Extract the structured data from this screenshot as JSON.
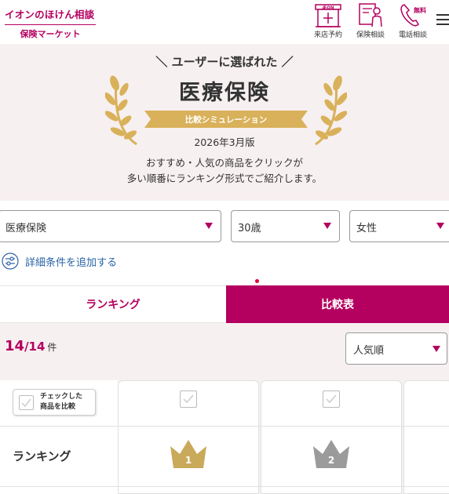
{
  "header": {
    "logo_main": "イオンのほけん相談",
    "logo_sub": "保険マーケット",
    "nav": [
      {
        "label": "来店予約",
        "icon": "store-icon"
      },
      {
        "label": "保険相談",
        "icon": "consultation-icon"
      },
      {
        "label": "電話相談",
        "icon": "phone-icon",
        "badge": "無料"
      }
    ],
    "store_sign": "ÆON"
  },
  "hero": {
    "tagline": "＼ ユーザーに選ばれた ／",
    "title": "医療保険",
    "ribbon": "比較シミュレーション",
    "date": "2026年3月版",
    "desc_line1": "おすすめ・人気の商品をクリックが",
    "desc_line2": "多い順番にランキング形式でご紹介します。"
  },
  "filters": {
    "insurance_type": "医療保険",
    "age": "30歳",
    "gender": "女性",
    "add_conditions": "詳細条件を追加する"
  },
  "tabs": {
    "ranking": "ランキング",
    "compare": "比較表",
    "active": "compare"
  },
  "results": {
    "shown": "14",
    "total": "14",
    "unit": "件",
    "sort": "人気順"
  },
  "table": {
    "check_compare_line1": "チェックした",
    "check_compare_line2": "商品を比較",
    "ranking_row_label": "ランキング",
    "products": [
      {
        "rank": "1",
        "crown_color": "#c9a95a"
      },
      {
        "rank": "2",
        "crown_color": "#9b9b9b"
      }
    ]
  },
  "colors": {
    "brand": "#b4005f",
    "gold": "#d9b15a",
    "hero_bg": "#f7f0f1"
  }
}
